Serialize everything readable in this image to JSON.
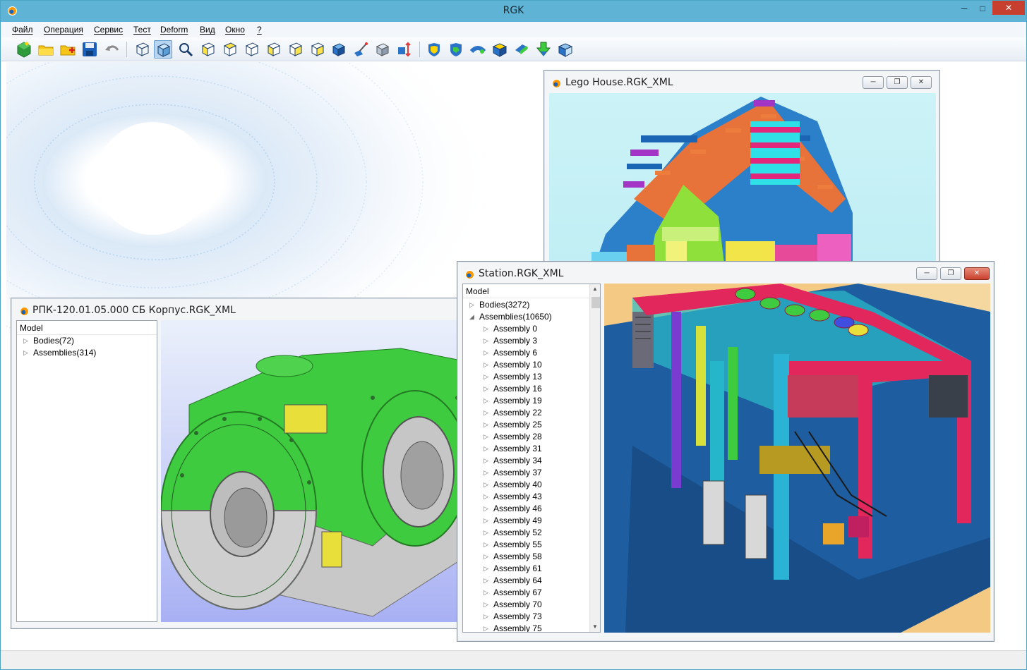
{
  "app": {
    "title": "RGK",
    "minimize": "─",
    "maximize": "□",
    "close": "✕"
  },
  "menu": [
    "Файл",
    "Операция",
    "Сервис",
    "Тест",
    "Deform",
    "Вид",
    "Окно",
    "?"
  ],
  "toolbar": {
    "buttons": [
      "new-model",
      "open-folder",
      "open-add",
      "save",
      "undo",
      "view-wireframe",
      "view-shaded",
      "zoom",
      "view-front",
      "view-back",
      "view-left",
      "view-right",
      "view-top",
      "view-bottom",
      "view-iso",
      "paint",
      "section",
      "transform",
      "body-yellow",
      "body-green",
      "pipe",
      "body-gold",
      "body-cyan",
      "body-arrow",
      "body-blue"
    ]
  },
  "windows": {
    "lego": {
      "title": "Lego House.RGK_XML",
      "btn_min": "─",
      "btn_max": "❐",
      "btn_close": "✕"
    },
    "rpk": {
      "title": "РПК-120.01.05.000 СБ Корпус.RGK_XML",
      "tree_header": "Model",
      "items": [
        {
          "label": "Bodies(72)"
        },
        {
          "label": "Assemblies(314)"
        }
      ]
    },
    "station": {
      "title": "Station.RGK_XML",
      "btn_min": "─",
      "btn_max": "❐",
      "btn_close": "✕",
      "tree_header": "Model",
      "items": [
        {
          "label": "Bodies(3272)",
          "expanded": false
        },
        {
          "label": "Assemblies(10650)",
          "expanded": true
        }
      ],
      "assemblies": [
        "Assembly 0",
        "Assembly 3",
        "Assembly 6",
        "Assembly 10",
        "Assembly 13",
        "Assembly 16",
        "Assembly 19",
        "Assembly 22",
        "Assembly 25",
        "Assembly 28",
        "Assembly 31",
        "Assembly 34",
        "Assembly 37",
        "Assembly 40",
        "Assembly 43",
        "Assembly 46",
        "Assembly 49",
        "Assembly 52",
        "Assembly 55",
        "Assembly 58",
        "Assembly 61",
        "Assembly 64",
        "Assembly 67",
        "Assembly 70",
        "Assembly 73",
        "Assembly 75"
      ],
      "scroll_up": "▲",
      "scroll_down": "▼"
    }
  },
  "colors": {
    "titlebar": "#5fb4d6",
    "close_button": "#c7402f",
    "model_green": "#3fcb3f",
    "lego_bg": "#c9f2f6",
    "station_floor": "#1d5da0"
  }
}
